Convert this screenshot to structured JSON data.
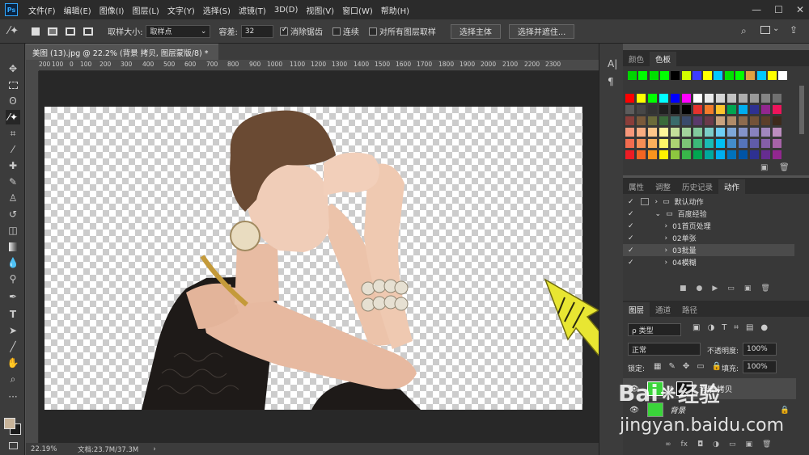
{
  "menubar": {
    "logo": "Ps",
    "items": [
      "文件(F)",
      "编辑(E)",
      "图像(I)",
      "图层(L)",
      "文字(Y)",
      "选择(S)",
      "滤镜(T)",
      "3D(D)",
      "视图(V)",
      "窗口(W)",
      "帮助(H)"
    ],
    "window_controls": [
      "—",
      "☐",
      "✕"
    ]
  },
  "options": {
    "sample_size_label": "取样大小:",
    "sample_size_value": "取样点",
    "tolerance_label": "容差:",
    "tolerance_value": "32",
    "antialias_label": "消除锯齿",
    "contiguous_label": "连续",
    "all_layers_label": "对所有图层取样",
    "select_subject": "选择主体",
    "select_mask": "选择并遮住..."
  },
  "document": {
    "tab_title": "美图 (13).jpg @ 22.2% (背景 拷贝, 图层蒙版/8) *",
    "close": "×",
    "ruler_ticks": [
      "200",
      "100",
      "0",
      "100",
      "200",
      "300",
      "400",
      "500",
      "600",
      "700",
      "800",
      "900",
      "1000",
      "1100",
      "1200",
      "1300",
      "1400",
      "1500",
      "1600",
      "1700",
      "1800",
      "1900",
      "2000",
      "2100",
      "2200",
      "2300"
    ]
  },
  "status": {
    "zoom": "22.19%",
    "doc_size": "文档:23.7M/37.3M",
    "arrow": "›"
  },
  "side_strip": {
    "icons": [
      "A|",
      "¶"
    ]
  },
  "swatches_panel": {
    "tabs": [
      "颜色",
      "色板"
    ],
    "recent": [
      "#00d400",
      "#00ff00",
      "#00e000",
      "#00ff00",
      "#000000",
      "#d4ff00",
      "#3c3cff",
      "#ffff00",
      "#00c8ff",
      "#00e000",
      "#00ff00",
      "#e0a040",
      "#00c8ff",
      "#ffff00",
      "#ffffff"
    ],
    "rows": [
      [
        "#ff0000",
        "#ffff00",
        "#00ff00",
        "#00ffff",
        "#0000ff",
        "#ff00ff",
        "#ffffff",
        "#ebebeb",
        "#d6d6d6",
        "#c2c2c2",
        "#adadad",
        "#999999",
        "#858585",
        "#707070"
      ],
      [
        "#5c5c5c",
        "#474747",
        "#333333",
        "#1f1f1f",
        "#0a0a0a",
        "#000000",
        "#e5322d",
        "#f27b2b",
        "#fcc42d",
        "#00a651",
        "#00aeef",
        "#2e3192",
        "#92278f",
        "#ed145b"
      ],
      [
        "#8a3e3a",
        "#7a5a3a",
        "#6b6b3a",
        "#3a6b3a",
        "#3a6b6b",
        "#3a4a6b",
        "#5a3a6b",
        "#6b3a4a",
        "#c9a27e",
        "#b08b68",
        "#8c6b4f",
        "#735238",
        "#5c3f2a",
        "#3d2a1c"
      ],
      [
        "#f7977a",
        "#f9ad81",
        "#fdc68a",
        "#fff79a",
        "#c4df9b",
        "#a3d39c",
        "#82ca9d",
        "#7bcdc8",
        "#6ecff6",
        "#7ea7d8",
        "#8493ca",
        "#8882be",
        "#a187be",
        "#bc8dbf"
      ],
      [
        "#f26c4f",
        "#f68e55",
        "#fbaf5c",
        "#fff467",
        "#acd372",
        "#7cc576",
        "#3bb878",
        "#1abbb4",
        "#00bff3",
        "#438cca",
        "#5574b9",
        "#605ca8",
        "#855fa8",
        "#a763a8"
      ],
      [
        "#ed1c24",
        "#f26522",
        "#f7941d",
        "#fff200",
        "#8dc63f",
        "#39b54a",
        "#00a651",
        "#00a99d",
        "#00aeef",
        "#0072bc",
        "#0054a6",
        "#2e3192",
        "#662d91",
        "#92278f"
      ]
    ]
  },
  "actions_panel": {
    "tabs": [
      "属性",
      "调整",
      "历史记录",
      "动作"
    ],
    "items": [
      {
        "label": "默认动作",
        "type": "set"
      },
      {
        "label": "百度经验",
        "type": "set"
      },
      {
        "label": "01首页处理",
        "type": "action"
      },
      {
        "label": "02单张",
        "type": "action"
      },
      {
        "label": "03批量",
        "type": "action"
      },
      {
        "label": "04模糊",
        "type": "action"
      }
    ],
    "footer_icons": [
      "■",
      "●",
      "▶",
      "▭",
      "▣",
      "🗑"
    ]
  },
  "layers_panel": {
    "tabs": [
      "图层",
      "通道",
      "路径"
    ],
    "filter": "ρ 类型",
    "blend_mode": "正常",
    "opacity_label": "不透明度:",
    "opacity_value": "100%",
    "lock_label": "锁定:",
    "fill_label": "填充:",
    "fill_value": "100%",
    "layers": [
      {
        "name": "背景 拷贝"
      },
      {
        "name": "背景"
      }
    ],
    "footer_icons": [
      "∞",
      "fx",
      "◘",
      "◑",
      "▭",
      "▣",
      "🗑"
    ]
  },
  "watermark": {
    "brand": "Bai",
    "brand_b": "经验",
    "url": "jingyan.baidu.com"
  },
  "colors": {
    "accent": "#e8e632",
    "foreground": "#c8b49a",
    "background": "#1a1a1a"
  }
}
